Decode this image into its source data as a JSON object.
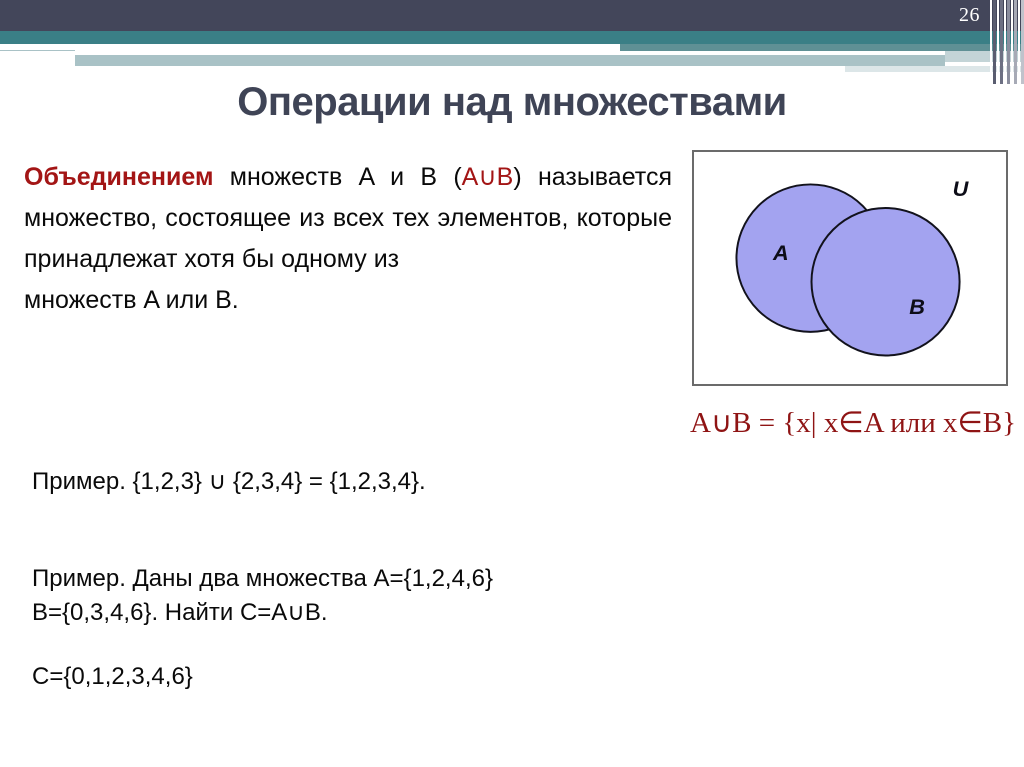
{
  "header": {
    "page_number": "26",
    "colors": {
      "navy": "#43465a",
      "teal": "#3a7f86",
      "teal_light": "#a9c2c6",
      "teal_pale": "#dce6e8"
    }
  },
  "title": "Операции над множествами",
  "definition": {
    "term": "Объединением",
    "text_after_term": " множеств  A и B (",
    "operation": "A∪B",
    "text_rest": ") называется множество, состоящее из всех тех элементов, которые принадлежат хотя бы одному из ",
    "last_line": "множеств  A или B.",
    "term_color": "#a31515"
  },
  "venn": {
    "universe_label": "U",
    "set_a_label": "A",
    "set_b_label": "B",
    "fill_color": "#a3a3f0",
    "stroke_color": "#12121c",
    "box_border_color": "#6b6b6b"
  },
  "formula": {
    "text": "A∪B = {x| x∈A или x∈B}",
    "color": "#8f1414"
  },
  "examples": {
    "example_1": "Пример. {1,2,3} ∪  {2,3,4} = {1,2,3,4}.",
    "example_2_line1": "Пример. Даны два множества A={1,2,4,6}",
    "example_2_line2": "B={0,3,4,6}. Найти C=A∪B.",
    "answer": "C={0,1,2,3,4,6}"
  }
}
